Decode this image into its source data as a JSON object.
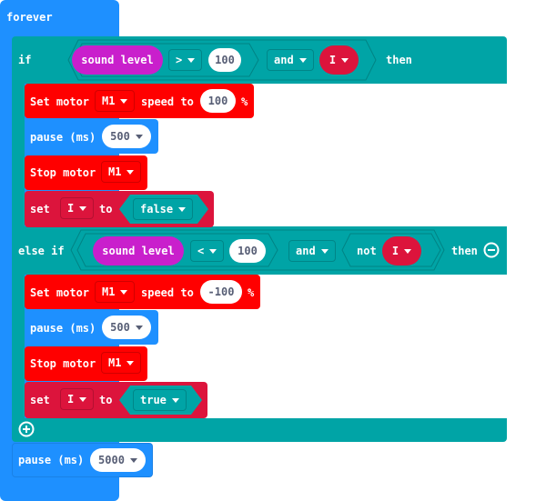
{
  "forever": {
    "label": "forever"
  },
  "if_block": {
    "if_label": "if",
    "then_label": "then",
    "cond1": {
      "left": "sound level",
      "operator": ">",
      "right": "100",
      "logic": "and",
      "variable": "I"
    },
    "body": [
      {
        "type": "set_motor",
        "label": "Set motor",
        "motor": "M1",
        "speed_label": "speed to",
        "speed": "100",
        "unit": "%"
      },
      {
        "type": "pause",
        "label": "pause (ms)",
        "value": "500"
      },
      {
        "type": "stop_motor",
        "label": "Stop motor",
        "motor": "M1"
      },
      {
        "type": "set_var",
        "label": "set",
        "variable": "I",
        "to_label": "to",
        "value": "false"
      }
    ],
    "else_if_label": "else if",
    "cond2": {
      "left": "sound level",
      "operator": "<",
      "right": "100",
      "logic": "and",
      "not_label": "not",
      "variable": "I"
    },
    "body2": [
      {
        "type": "set_motor",
        "label": "Set motor",
        "motor": "M1",
        "speed_label": "speed to",
        "speed": "-100",
        "unit": "%"
      },
      {
        "type": "pause",
        "label": "pause (ms)",
        "value": "500"
      },
      {
        "type": "stop_motor",
        "label": "Stop motor",
        "motor": "M1"
      },
      {
        "type": "set_var",
        "label": "set",
        "variable": "I",
        "to_label": "to",
        "value": "true"
      }
    ]
  },
  "final_pause": {
    "label": "pause (ms)",
    "value": "5000"
  },
  "icons": {
    "remove": "minus-circle-icon",
    "add": "plus-circle-icon"
  },
  "colors": {
    "loops": "#1e90ff",
    "logic": "#00a4a6",
    "motor": "#ff0000",
    "variables": "#dc143c",
    "input": "#c91fcc"
  }
}
